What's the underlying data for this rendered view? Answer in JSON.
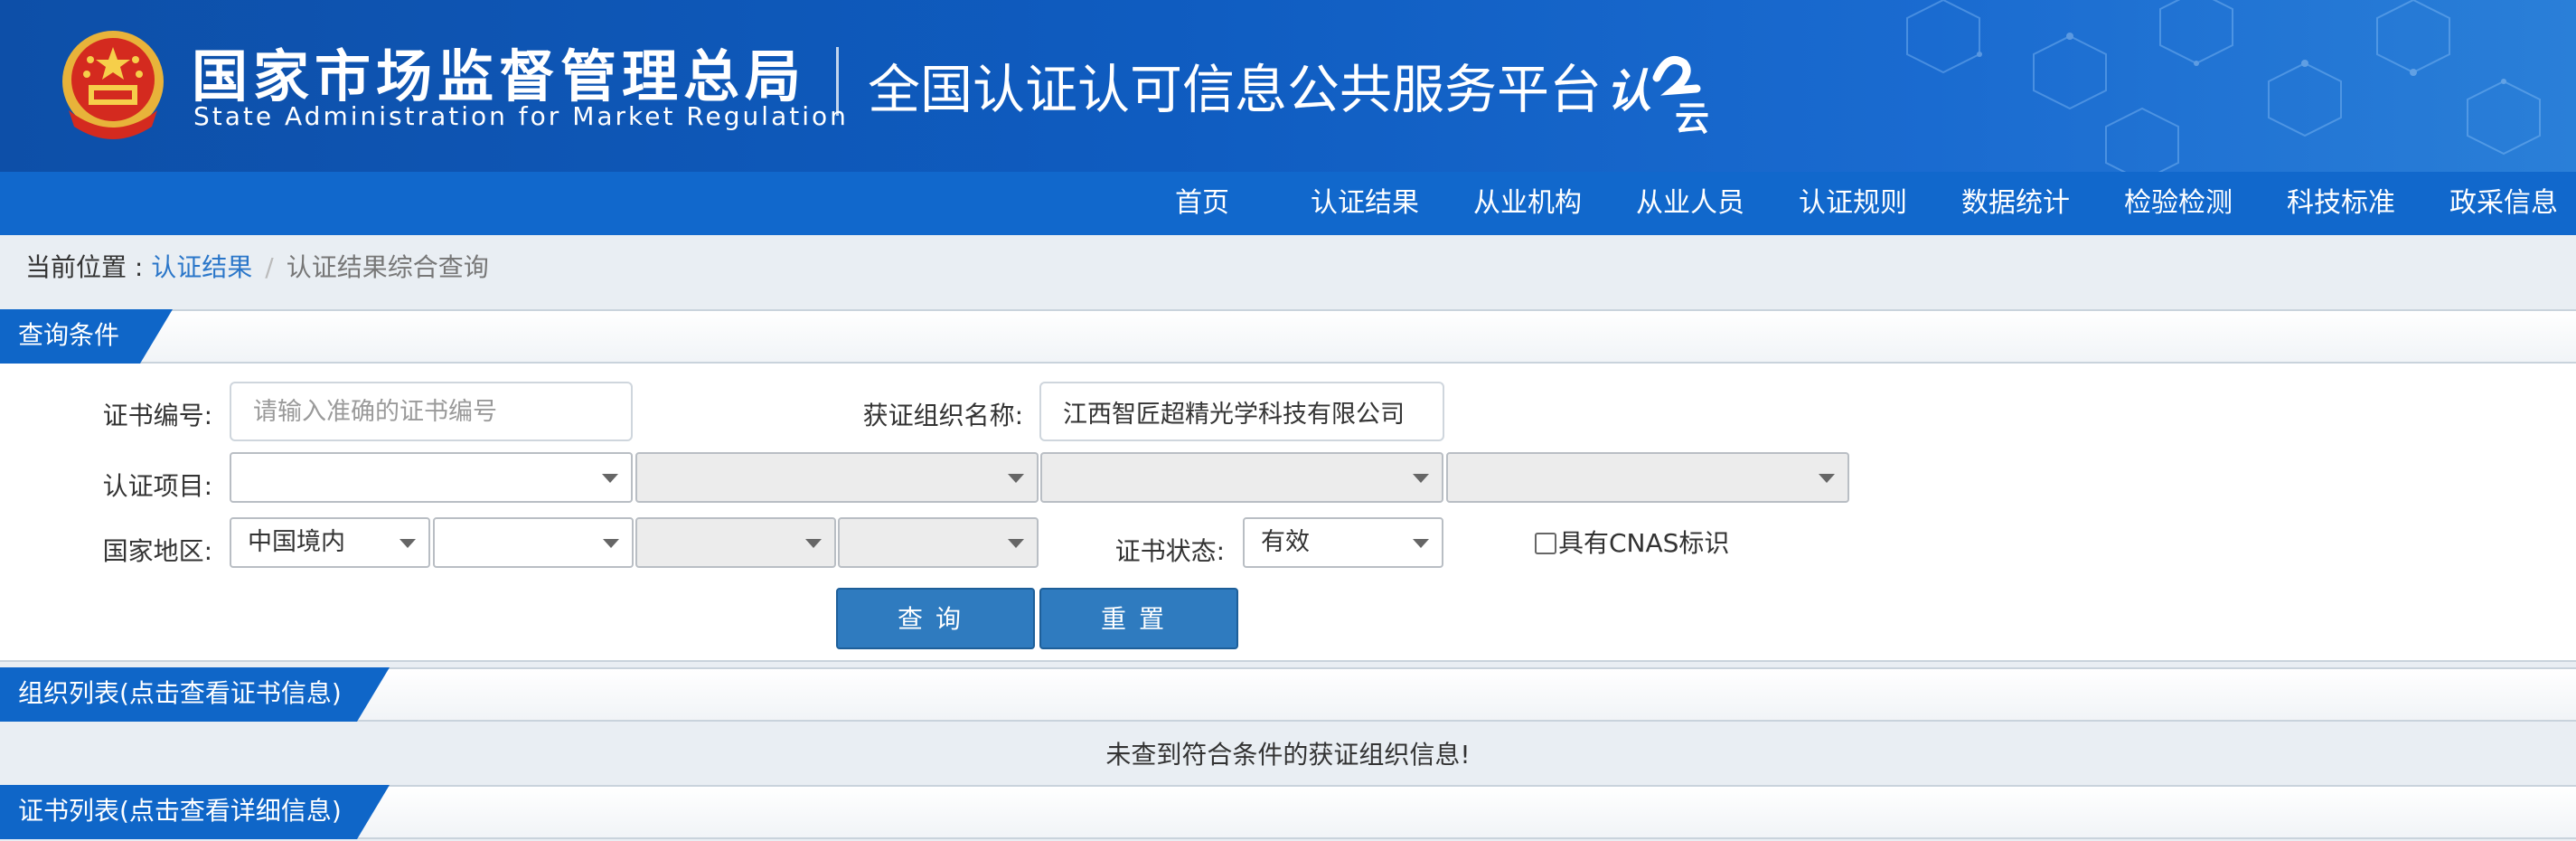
{
  "header": {
    "agency_cn": "国家市场监督管理总局",
    "agency_en": "State Administration  for  Market Regulation",
    "platform_title": "全国认证认可信息公共服务平台",
    "logo_text": "认云",
    "emblem_icon": "national-emblem-icon"
  },
  "nav": {
    "items": [
      {
        "label": "首页"
      },
      {
        "label": "认证结果"
      },
      {
        "label": "从业机构"
      },
      {
        "label": "从业人员"
      },
      {
        "label": "认证规则"
      },
      {
        "label": "数据统计"
      },
      {
        "label": "检验检测"
      },
      {
        "label": "科技标准"
      },
      {
        "label": "政采信息"
      }
    ]
  },
  "breadcrumb": {
    "prefix": "当前位置 : ",
    "link": "认证结果",
    "separator": "/",
    "current": "认证结果综合查询"
  },
  "query": {
    "section_title": "查询条件",
    "cert_no_label": "证书编号:",
    "cert_no_placeholder": "请输入准确的证书编号",
    "cert_no_value": "",
    "org_name_label": "获证组织名称:",
    "org_name_value": "江西智匠超精光学科技有限公司",
    "cert_item_label": "认证项目:",
    "region_label": "国家地区:",
    "region_selected": "中国境内",
    "status_label": "证书状态:",
    "status_selected": "有效",
    "cnas_label": "具有CNAS标识",
    "cnas_checked": false,
    "search_button": "查询",
    "reset_button": "重置"
  },
  "org_list": {
    "section_title": "组织列表(点击查看证书信息)",
    "empty_message": "未查到符合条件的获证组织信息!"
  },
  "cert_list": {
    "section_title": "证书列表(点击查看详细信息)"
  },
  "colors": {
    "header_blue": "#0f5cc0",
    "nav_blue": "#1168cc",
    "tab_blue": "#0f66c8",
    "button_blue": "#2f7bbf",
    "link_blue": "#2a76c9"
  }
}
